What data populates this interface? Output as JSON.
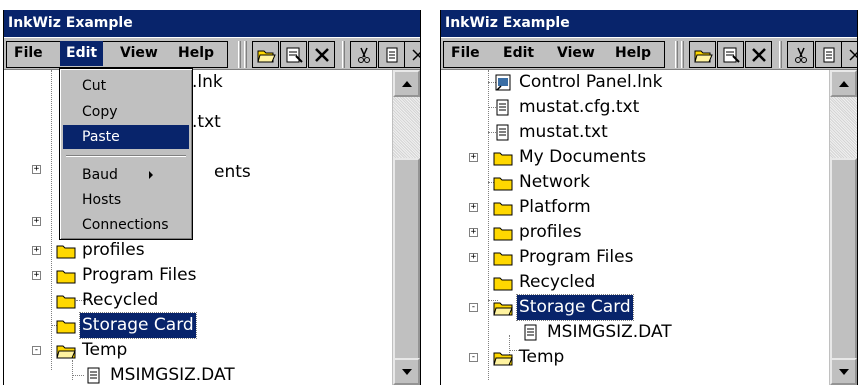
{
  "left": {
    "title": "InkWiz Example",
    "menus": [
      "File",
      "Edit",
      "View",
      "Help"
    ],
    "active_menu": "Edit",
    "tree_partial": [
      ".lnk",
      ".txt",
      "ents"
    ],
    "tree": [
      {
        "label": "profiles",
        "icon": "folder-icon",
        "expander": "+"
      },
      {
        "label": "Program Files",
        "icon": "folder-icon",
        "expander": "+"
      },
      {
        "label": "Recycled",
        "icon": "folder-icon"
      },
      {
        "label": "Storage Card",
        "icon": "folder-icon",
        "selected": true
      },
      {
        "label": "Temp",
        "icon": "folder-open-icon",
        "expander": "-"
      },
      {
        "label": "MSIMGSIZ.DAT",
        "icon": "file-icon"
      }
    ],
    "dropdown": {
      "items": [
        "Cut",
        "Copy",
        "Paste",
        "Baud",
        "Hosts",
        "Connections"
      ],
      "highlighted": "Paste",
      "submenu_item": "Baud"
    }
  },
  "right": {
    "title": "InkWiz Example",
    "menus": [
      "File",
      "Edit",
      "View",
      "Help"
    ],
    "tree": [
      {
        "label": "Control Panel.lnk",
        "icon": "shortcut-icon"
      },
      {
        "label": "mustat.cfg.txt",
        "icon": "file-icon"
      },
      {
        "label": "mustat.txt",
        "icon": "file-icon"
      },
      {
        "label": "My Documents",
        "icon": "folder-icon",
        "expander": "+"
      },
      {
        "label": "Network",
        "icon": "folder-icon"
      },
      {
        "label": "Platform",
        "icon": "folder-icon",
        "expander": "+"
      },
      {
        "label": "profiles",
        "icon": "folder-icon",
        "expander": "+"
      },
      {
        "label": "Program Files",
        "icon": "folder-icon",
        "expander": "+"
      },
      {
        "label": "Recycled",
        "icon": "folder-icon"
      },
      {
        "label": "Storage Card",
        "icon": "folder-open-icon",
        "expander": "-",
        "selected": true
      },
      {
        "label": "MSIMGSIZ.DAT",
        "icon": "file-icon"
      },
      {
        "label": "Temp",
        "icon": "folder-open-icon",
        "expander": "-"
      }
    ]
  },
  "toolbar_icons": [
    "open-folder-icon",
    "properties-icon",
    "delete-icon",
    "cut-icon",
    "page-icon",
    "close-icon"
  ],
  "colors": {
    "highlight": "#08246b",
    "chrome": "#c0c0c0",
    "folder": "#ffd800"
  }
}
